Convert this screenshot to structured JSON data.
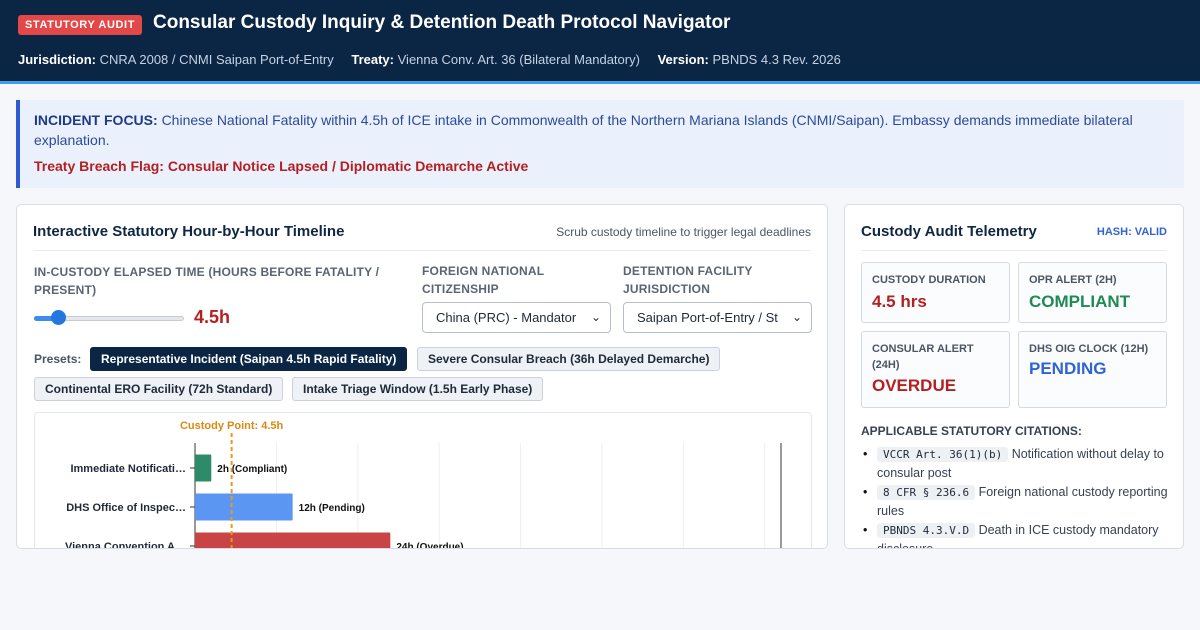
{
  "header": {
    "badge": "STATUTORY AUDIT",
    "title": "Consular Custody Inquiry & Detention Death Protocol Navigator",
    "jurisdiction_label": "Jurisdiction:",
    "jurisdiction_value": "CNRA 2008 / CNMI Saipan Port-of-Entry",
    "treaty_label": "Treaty:",
    "treaty_value": "Vienna Conv. Art. 36 (Bilateral Mandatory)",
    "version_label": "Version:",
    "version_value": "PBNDS 4.3 Rev. 2026"
  },
  "incident": {
    "focus_label": "INCIDENT FOCUS:",
    "focus_text": "Chinese National Fatality within 4.5h of ICE intake in Commonwealth of the Northern Mariana Islands (CNMI/Saipan). Embassy demands immediate bilateral explanation.",
    "flag": "Treaty Breach Flag: Consular Notice Lapsed / Diplomatic Demarche Active"
  },
  "timeline": {
    "title": "Interactive Statutory Hour-by-Hour Timeline",
    "hint": "Scrub custody timeline to trigger legal deadlines",
    "elapsed_label_1": "IN-CUSTODY ELAPSED TIME (HOURS BEFORE FATALITY /",
    "elapsed_label_2": "PRESENT)",
    "elapsed_value": "4.5h",
    "elapsed_hours": 4.5,
    "citizenship_label_1": "FOREIGN NATIONAL",
    "citizenship_label_2": "CITIZENSHIP",
    "citizenship_value": "China (PRC) - Mandator",
    "facility_label_1": "DETENTION FACILITY",
    "facility_label_2": "JURISDICTION",
    "facility_value": "Saipan Port-of-Entry / St",
    "presets_label": "Presets:",
    "presets": [
      "Representative Incident (Saipan 4.5h Rapid Fatality)",
      "Severe Consular Breach (36h Delayed Demarche)",
      "Continental ERO Facility (72h Standard)",
      "Intake Triage Window (1.5h Early Phase)"
    ],
    "active_preset": 0
  },
  "chart_data": {
    "type": "bar",
    "orientation": "horizontal",
    "categories": [
      "Immediate Notificati…",
      "DHS Office of Inspec…",
      "Vienna Convention A…"
    ],
    "values": [
      2,
      12,
      24
    ],
    "data_labels": [
      "2h (Compliant)",
      "12h (Pending)",
      "24h (Overdue)"
    ],
    "colors": [
      "#2e8b6a",
      "#5b96f2",
      "#c94444"
    ],
    "xlim": [
      0,
      72
    ],
    "marker_label": "Custody Point: 4.5h",
    "marker_value": 4.5,
    "marker_color": "#e89a1b"
  },
  "telemetry": {
    "title": "Custody Audit Telemetry",
    "hash": "HASH: VALID",
    "tiles": [
      {
        "label": "CUSTODY DURATION",
        "value": "4.5 hrs",
        "color": "#b42020"
      },
      {
        "label": "OPR ALERT (2H)",
        "value": "COMPLIANT",
        "color": "#1f8a52"
      },
      {
        "label": "CONSULAR ALERT (24H)",
        "value": "OVERDUE",
        "color": "#b42020"
      },
      {
        "label": "DHS OIG CLOCK (12H)",
        "value": "PENDING",
        "color": "#2f63d6"
      }
    ],
    "citations_title": "APPLICABLE STATUTORY CITATIONS:",
    "citations": [
      {
        "code": "VCCR Art. 36(1)(b)",
        "text": "Notification without delay to consular post"
      },
      {
        "code": "8 CFR § 236.6",
        "text": "Foreign national custody reporting rules"
      },
      {
        "code": "PBNDS 4.3.V.D",
        "text": "Death in ICE custody mandatory disclosure"
      }
    ]
  }
}
